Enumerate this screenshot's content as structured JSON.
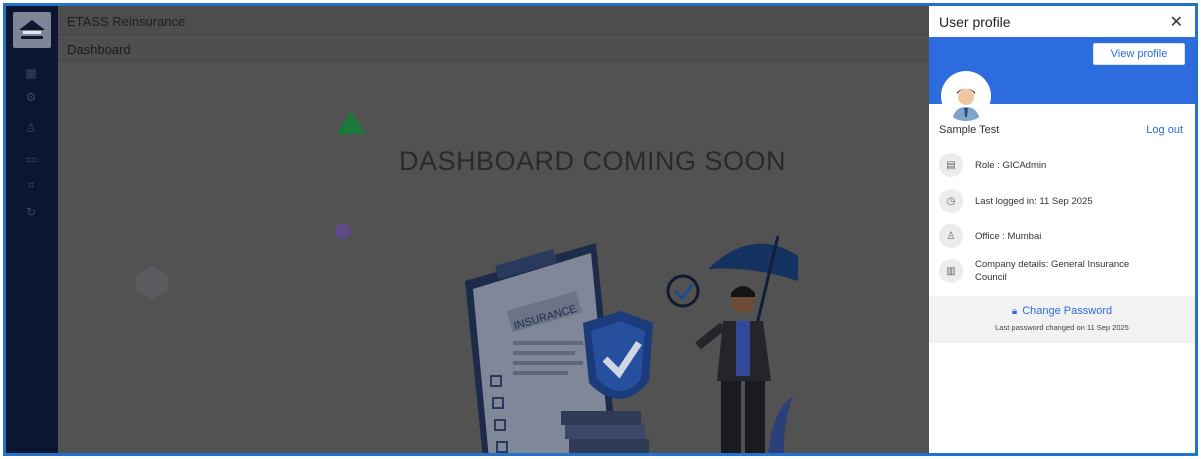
{
  "app": {
    "title": "ETASS Reinsurance"
  },
  "page": {
    "title": "Dashboard",
    "message": "DASHBOARD COMING SOON"
  },
  "illustration": {
    "badge_text": "INSURANCE"
  },
  "nav": {
    "icons": [
      "dashboard-icon",
      "settings-icon",
      "user-icon",
      "monitor-icon",
      "tag-icon",
      "refresh-icon"
    ]
  },
  "profile": {
    "title": "User profile",
    "close": "✕",
    "view_profile": "View profile",
    "name": "Sample Test",
    "logout": "Log out",
    "role": "Role : GICAdmin",
    "last_login": "Last logged in: 11 Sep 2025",
    "office": "Office : Mumbai",
    "company": "Company details: General Insurance Council",
    "change_password": "Change Password",
    "password_note": "Last password changed on 11 Sep 2025"
  },
  "colors": {
    "accent": "#2d6cdf",
    "rail": "#0d1630",
    "frame": "#1f73c9"
  }
}
